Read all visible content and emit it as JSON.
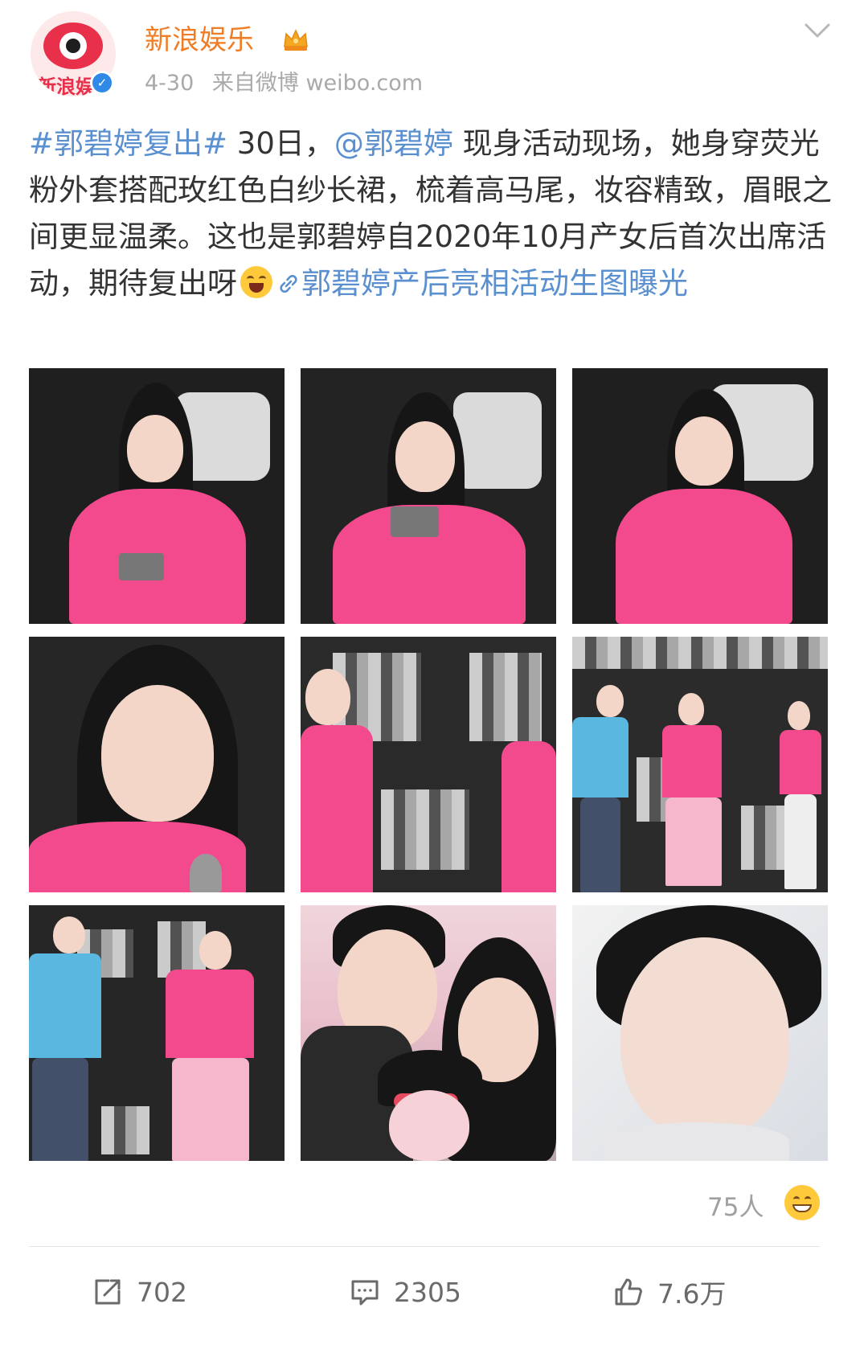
{
  "header": {
    "avatar_text": "新浪娱乐",
    "username": "新浪娱乐",
    "date": "4-30",
    "source": "来自微博 weibo.com"
  },
  "post": {
    "topic": "#郭碧婷复出#",
    "segment1": " 30日，",
    "mention": "@郭碧婷",
    "segment2": " 现身活动现场，她身穿荧光粉外套搭配玫红色白纱长裙，梳着高马尾，妆容精致，眉眼之间更显温柔。这也是郭碧婷自2020年10月产女后首次出席活动，期待复出呀",
    "link_text": "郭碧婷产后亮相活动生图曝光"
  },
  "footer": {
    "likers_count": "75人",
    "repost_count": "702",
    "comment_count": "2305",
    "like_count": "7.6万"
  },
  "colors": {
    "username": "#ef7d26",
    "link": "#5a8fd0",
    "text": "#333333",
    "muted": "#a9a9a9"
  }
}
